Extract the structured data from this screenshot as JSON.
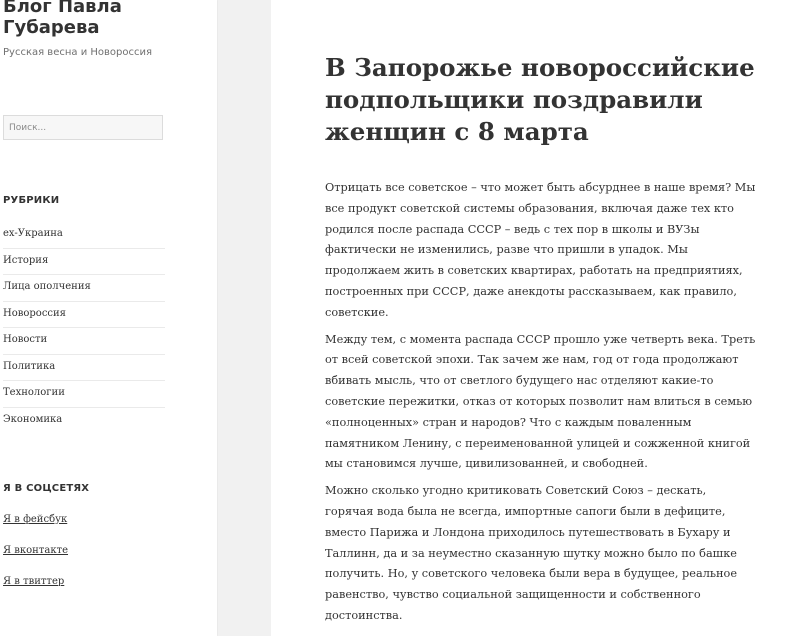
{
  "site": {
    "title": "Блог Павла Губарева",
    "description": "Русская весна и Новороссия"
  },
  "search": {
    "placeholder": "Поиск..."
  },
  "categories": {
    "title": "РУБРИКИ",
    "items": [
      "ex-Украина",
      "История",
      "Лица ополчения",
      "Новороссия",
      "Новости",
      "Политика",
      "Технологии",
      "Экономика"
    ]
  },
  "social": {
    "title": "Я В СОЦСЕТЯХ",
    "links": [
      "Я в фейсбук",
      "Я вконтакте",
      "Я в твиттер"
    ]
  },
  "article": {
    "title": "В Запорожье новороссийские подпольщики поздравили женщин с 8 марта",
    "paragraphs": [
      "Отрицать все советское – что может быть абсурднее в наше время? Мы все продукт советской системы образования, включая даже тех кто родился после распада СССР – ведь с тех пор в школы и ВУЗы фактически не изменились, разве что пришли в упадок.  Мы продолжаем жить в советских квартирах, работать на предприятиях, построенных при СССР, даже анекдоты рассказываем, как правило, советские.",
      "Между тем, с момента распада СССР прошло уже четверть века. Треть от всей советской эпохи. Так зачем же нам, год от года продолжают вбивать мысль, что от светлого будущего нас отделяют какие-то советские пережитки, отказ от которых позволит нам влиться в семью «полноценных» стран и народов? Что с каждым поваленным памятником Ленину, с переименованной улицей и сожженной книгой мы становимся лучше, цивилизованней, и свободней.",
      "Можно сколько угодно критиковать Советский Союз – дескать, горячая вода была не всегда, импортные сапоги были в дефиците, вместо Парижа и Лондона приходилось путешествовать в Бухару и Таллинн, да и за неуместно сказанную шутку можно было по башке получить. Но, у советского человека были вера в будущее, реальное равенство, чувство социальной защищенности и собственного достоинства."
    ]
  }
}
